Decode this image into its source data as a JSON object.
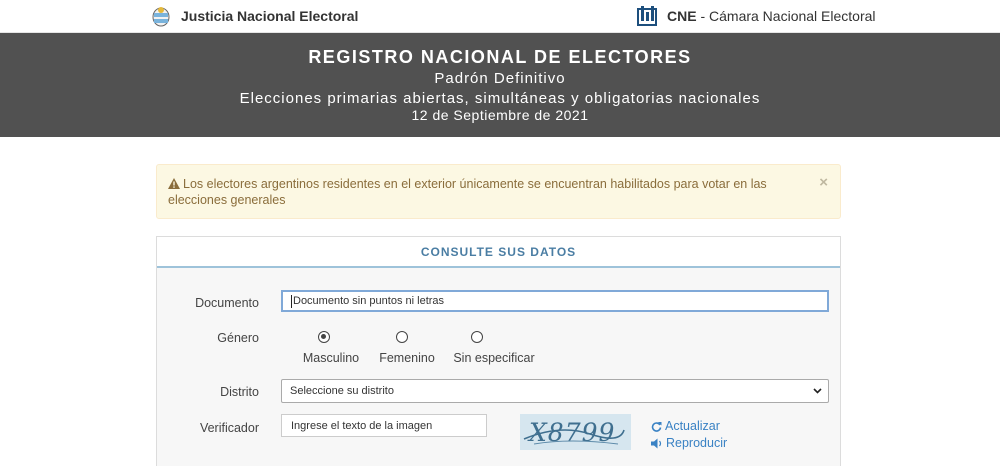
{
  "topbar": {
    "left_brand": "Justicia Nacional Electoral",
    "right_brand_bold": "CNE",
    "right_brand_rest": " - Cámara Nacional Electoral"
  },
  "hero": {
    "title": "REGISTRO NACIONAL DE ELECTORES",
    "subtitle": "Padrón Definitivo",
    "election": "Elecciones primarias abiertas, simultáneas y obligatorias nacionales",
    "date": "12 de Septiembre de 2021"
  },
  "alert": {
    "text": "Los electores argentinos residentes en el exterior únicamente se encuentran habilitados para votar en las elecciones generales",
    "close": "×"
  },
  "form": {
    "heading": "CONSULTE SUS DATOS",
    "documento": {
      "label": "Documento",
      "placeholder": "Documento sin puntos ni letras"
    },
    "genero": {
      "label": "Género",
      "options": [
        "Masculino",
        "Femenino",
        "Sin especificar"
      ],
      "selected": "Masculino"
    },
    "distrito": {
      "label": "Distrito",
      "selected": "Seleccione su distrito"
    },
    "verificador": {
      "label": "Verificador",
      "placeholder": "Ingrese el texto de la imagen",
      "captcha_text": "X8799",
      "refresh": "Actualizar",
      "play": "Reproducir"
    }
  },
  "colors": {
    "hero_bg": "#515151",
    "alert_bg": "#fcf8e3",
    "alert_text": "#8a6d3b",
    "link": "#3a82c4",
    "heading": "#4a7da3"
  },
  "icons": [
    "argentina-seal-icon",
    "cne-building-icon",
    "warning-triangle-icon",
    "close-icon",
    "chevron-down-icon",
    "refresh-icon",
    "speaker-icon"
  ]
}
